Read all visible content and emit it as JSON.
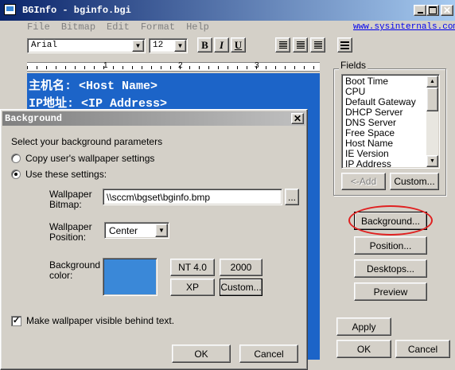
{
  "main_window": {
    "title": "BGInfo - bginfo.bgi",
    "menu": [
      "File",
      "Bitmap",
      "Edit",
      "Format",
      "Help"
    ],
    "link": "www.sysinternals.com",
    "font_name": "Arial",
    "font_size": "12",
    "format_buttons": [
      "B",
      "I",
      "U"
    ],
    "ruler_marks": [
      "1",
      "2",
      "3"
    ],
    "editor_lines": [
      "主机名: <Host Name>",
      "IP地址: <IP Address>"
    ],
    "fields_label": "Fields",
    "fields": [
      "Boot Time",
      "CPU",
      "Default Gateway",
      "DHCP Server",
      "DNS Server",
      "Free Space",
      "Host Name",
      "IE Version",
      "IP Address"
    ],
    "add_button": "<-Add",
    "custom_button": "Custom...",
    "background_button": "Background...",
    "position_button": "Position...",
    "desktops_button": "Desktops...",
    "preview_button": "Preview",
    "apply_button": "Apply",
    "ok_button": "OK",
    "cancel_button": "Cancel",
    "highlight_color": "#e02020"
  },
  "dialog": {
    "title": "Background",
    "intro": "Select your background parameters",
    "option_copy": "Copy user's wallpaper settings",
    "option_use": "Use these settings:",
    "wallpaper_bitmap_label": "Wallpaper Bitmap:",
    "wallpaper_bitmap_value": "\\\\sccm\\bgset\\bginfo.bmp",
    "browse_button": "...",
    "wallpaper_position_label": "Wallpaper Position:",
    "wallpaper_position_value": "Center",
    "background_color_label": "Background color:",
    "background_color": "#3a88d8",
    "color_buttons": [
      "NT 4.0",
      "2000",
      "XP",
      "Custom..."
    ],
    "make_visible_label": "Make wallpaper visible behind text.",
    "make_visible_checked": true,
    "ok_button": "OK",
    "cancel_button": "Cancel"
  }
}
